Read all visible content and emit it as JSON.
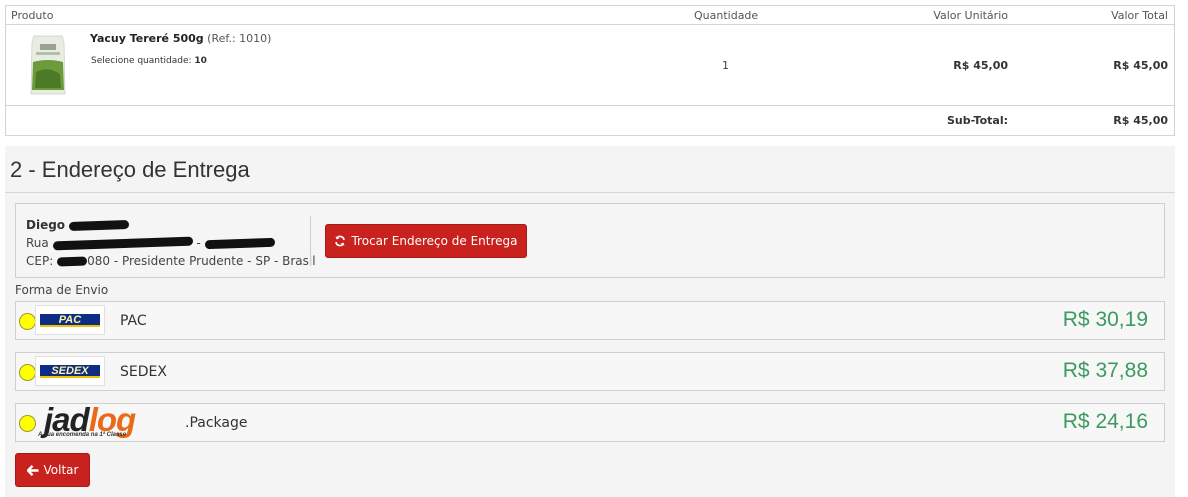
{
  "cart": {
    "headers": {
      "product": "Produto",
      "quantity": "Quantidade",
      "unit_price": "Valor Unitário",
      "total": "Valor Total"
    },
    "item": {
      "name": "Yacuy Tereré 500g",
      "ref": "(Ref.: 1010)",
      "select_label": "Selecione quantidade:",
      "select_value": "10",
      "quantity": "1",
      "unit_price": "R$ 45,00",
      "total": "R$ 45,00"
    },
    "subtotal_label": "Sub-Total:",
    "subtotal_value": "R$ 45,00"
  },
  "delivery": {
    "title": "2 - Endereço de Entrega",
    "address": {
      "name": "Diego",
      "street_prefix": "Rua",
      "street_separator": "-",
      "cep_label": "CEP:",
      "cep_suffix": "080 - Presidente Prudente - SP - Brasil"
    },
    "change_button": "Trocar Endereço de Entrega",
    "shipping_label": "Forma de Envio",
    "options": [
      {
        "name": "PAC",
        "price": "R$ 30,19",
        "logo_text": "PAC"
      },
      {
        "name": "SEDEX",
        "price": "R$ 37,88",
        "logo_text": "SEDEX"
      },
      {
        "name": ".Package",
        "price": "R$ 24,16",
        "logo_text_1": "jad",
        "logo_text_2": "log",
        "logo_tagline": "A sua encomenda na 1ª Classe"
      }
    ],
    "back_button": "Voltar"
  },
  "colors": {
    "accent_red": "#c9211e",
    "price_green": "#3c9a5f",
    "radio_yellow": "#ffff00"
  }
}
